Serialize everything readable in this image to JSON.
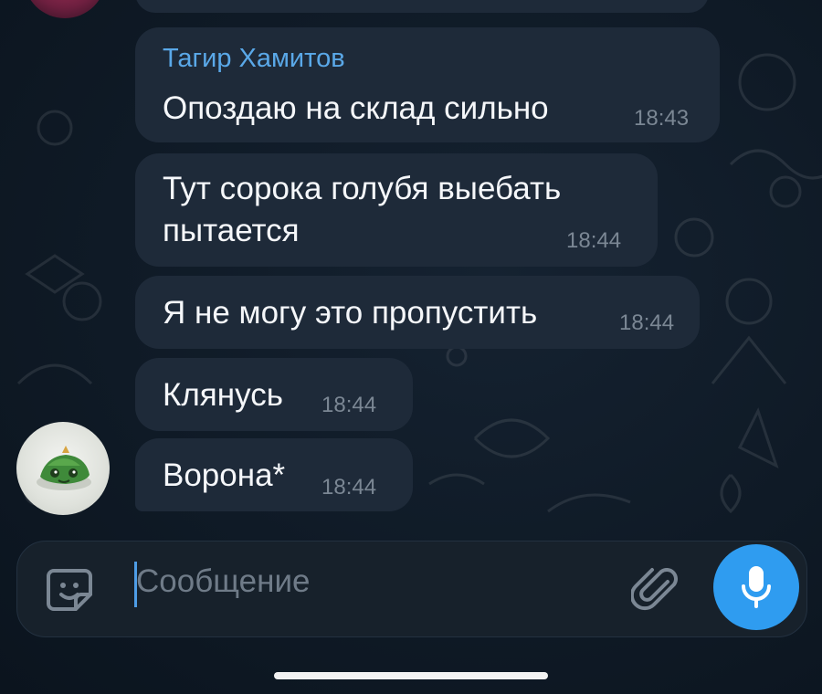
{
  "chat": {
    "sender_name": "Тагир Хамитов",
    "messages": [
      {
        "text": "Опоздаю на склад сильно",
        "time": "18:43"
      },
      {
        "line1": "Тут сорока голубя выебать",
        "line2": "пытается",
        "time": "18:44"
      },
      {
        "text": "Я не могу это пропустить",
        "time": "18:44"
      },
      {
        "text": "Клянусь",
        "time": "18:44"
      },
      {
        "text": "Ворона*",
        "time": "18:44"
      }
    ]
  },
  "composer": {
    "placeholder": "Сообщение",
    "icons": {
      "sticker": "sticker-smile-icon",
      "attach": "paperclip-icon",
      "mic": "microphone-icon"
    }
  },
  "colors": {
    "background": "#0e1621",
    "bubble": "#1e2a39",
    "sender_name": "#5aa8e8",
    "time": "#7b8794",
    "accent": "#2f9cf0"
  }
}
